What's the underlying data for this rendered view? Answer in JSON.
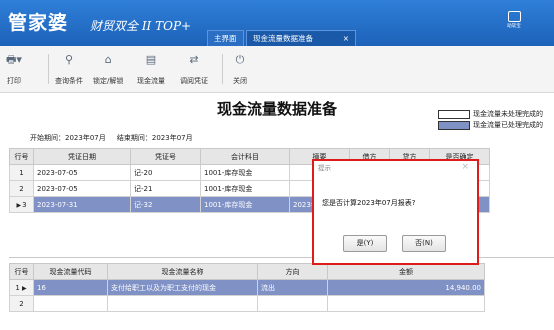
{
  "app": {
    "logo": "管家婆",
    "subtitle": "财贸双全 II TOP+"
  },
  "tabs": [
    {
      "label": "主界面"
    },
    {
      "label": "现金流量数据准备",
      "close": "×"
    }
  ],
  "quick_access": {
    "label": "助软宝"
  },
  "toolbar": {
    "print": "打印",
    "query": "查询条件",
    "lock": "锁定/解锁",
    "cashflow": "现金流量",
    "adjust": "调阅凭证",
    "close": "关闭"
  },
  "page": {
    "title": "现金流量数据准备"
  },
  "legend": [
    {
      "label": "现金流量未处理完成的",
      "color": "#ffffff"
    },
    {
      "label": "现金流量已处理完成的",
      "color": "#7f91c5"
    }
  ],
  "period": {
    "start_label": "开始期间：",
    "start": "2023年07月",
    "end_label": "结束期间：",
    "end": "2023年07月"
  },
  "voucher_table": {
    "headers": [
      "行号",
      "凭证日期",
      "凭证号",
      "会计科目",
      "摘要",
      "借方",
      "贷方",
      "是否确定"
    ],
    "rows": [
      [
        "1",
        "2023-07-05",
        "记-20",
        "1001-库存现金",
        "",
        "",
        "",
        ""
      ],
      [
        "2",
        "2023-07-05",
        "记-21",
        "1001-库存现金",
        "",
        "",
        "",
        ""
      ],
      [
        "3",
        "2023-07-31",
        "记-32",
        "1001-库存现金",
        "2023年07月",
        "",
        "",
        ""
      ]
    ]
  },
  "flow_table": {
    "headers": [
      "行号",
      "现金流量代码",
      "现金流量名称",
      "方向",
      "金额"
    ],
    "rows": [
      [
        "1",
        "16",
        "支付给职工以及为职工支付的现金",
        "流出",
        "14,940.00"
      ],
      [
        "2",
        "",
        "",
        "",
        ""
      ]
    ]
  },
  "dialog": {
    "title": "提示",
    "close": "×",
    "message": "您是否计算2023年07月报表?",
    "yes": "是(Y)",
    "no": "否(N)"
  }
}
